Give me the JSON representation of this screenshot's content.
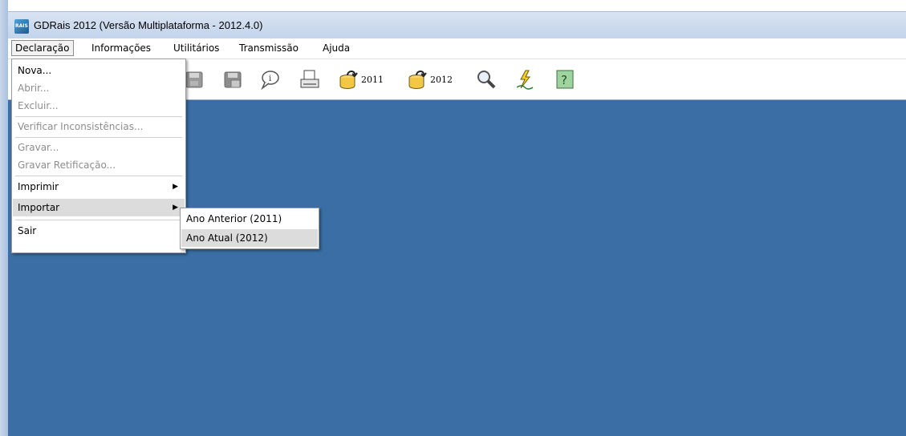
{
  "window": {
    "title": "GDRais 2012 (Versão Multiplataforma - 2012.4.0)"
  },
  "menubar": {
    "items": [
      {
        "label": "Declaração"
      },
      {
        "label": "Informações"
      },
      {
        "label": "Utilitários"
      },
      {
        "label": "Transmissão"
      },
      {
        "label": "Ajuda"
      }
    ]
  },
  "toolbar": {
    "buttons": [
      {
        "icon": "save-icon"
      },
      {
        "icon": "save-as-icon"
      },
      {
        "icon": "info-bubble-icon"
      },
      {
        "icon": "print-icon"
      },
      {
        "icon": "database-icon",
        "label": "2011"
      },
      {
        "icon": "database-icon",
        "label": "2012"
      },
      {
        "icon": "magnifier-icon"
      },
      {
        "icon": "transmit-icon"
      },
      {
        "icon": "help-icon"
      }
    ]
  },
  "declaracao_menu": {
    "items": [
      {
        "label": "Nova...",
        "enabled": true
      },
      {
        "label": "Abrir...",
        "enabled": false
      },
      {
        "label": "Excluir...",
        "enabled": false
      },
      {
        "label": "Verificar Inconsistências...",
        "enabled": false
      },
      {
        "label": "Gravar...",
        "enabled": false
      },
      {
        "label": "Gravar Retificação...",
        "enabled": false
      },
      {
        "label": "Imprimir",
        "enabled": true
      },
      {
        "label": "Importar",
        "enabled": true
      },
      {
        "label": "Sair",
        "enabled": true
      }
    ]
  },
  "importar_submenu": {
    "items": [
      {
        "label": "Ano Anterior (2011)"
      },
      {
        "label": "Ano Atual (2012)"
      }
    ]
  }
}
